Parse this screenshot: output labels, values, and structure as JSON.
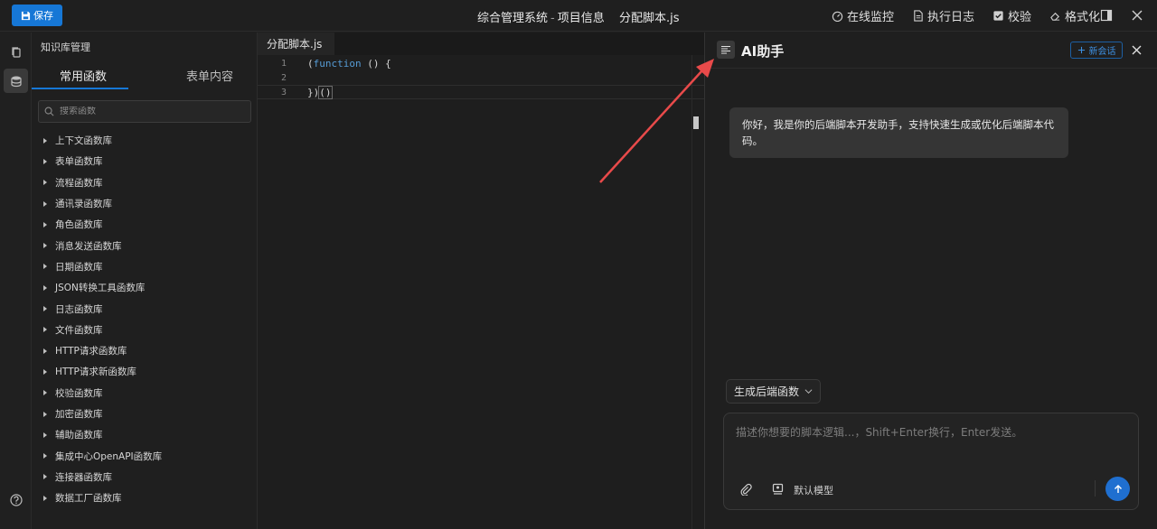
{
  "topbar": {
    "save_label": "保存",
    "system_name": "综合管理系统",
    "separator": "-",
    "project_name": "项目信息",
    "file_name": "分配脚本.js",
    "actions": {
      "monitor": "在线监控",
      "log": "执行日志",
      "validate": "校验",
      "format": "格式化"
    }
  },
  "sidebar": {
    "title": "知识库管理",
    "tabs": {
      "common": "常用函数",
      "form": "表单内容"
    },
    "search_placeholder": "搜索函数",
    "items": [
      "上下文函数库",
      "表单函数库",
      "流程函数库",
      "通讯录函数库",
      "角色函数库",
      "消息发送函数库",
      "日期函数库",
      "JSON转换工具函数库",
      "日志函数库",
      "文件函数库",
      "HTTP请求函数库",
      "HTTP请求新函数库",
      "校验函数库",
      "加密函数库",
      "辅助函数库",
      "集成中心OpenAPI函数库",
      "连接器函数库",
      "数据工厂函数库"
    ]
  },
  "editor": {
    "tab_label": "分配脚本.js",
    "lines": [
      {
        "num": "1",
        "pre": "(",
        "kw": "function",
        "post": " () {"
      },
      {
        "num": "2",
        "pre": "",
        "kw": "",
        "post": ""
      },
      {
        "num": "3",
        "pre": "})",
        "kw": "",
        "post": "()"
      }
    ]
  },
  "ai": {
    "title": "AI助手",
    "new_chat": "新会话",
    "greeting": "你好，我是你的后端脚本开发助手，支持快速生成或优化后端脚本代码。",
    "generate_label": "生成后端函数",
    "input_placeholder": "描述你想要的脚本逻辑...，Shift+Enter换行，Enter发送。",
    "model_label": "默认模型"
  },
  "colors": {
    "accent": "#1677d6",
    "keyword": "#569cd6",
    "annotation_arrow": "#e84a4a"
  }
}
